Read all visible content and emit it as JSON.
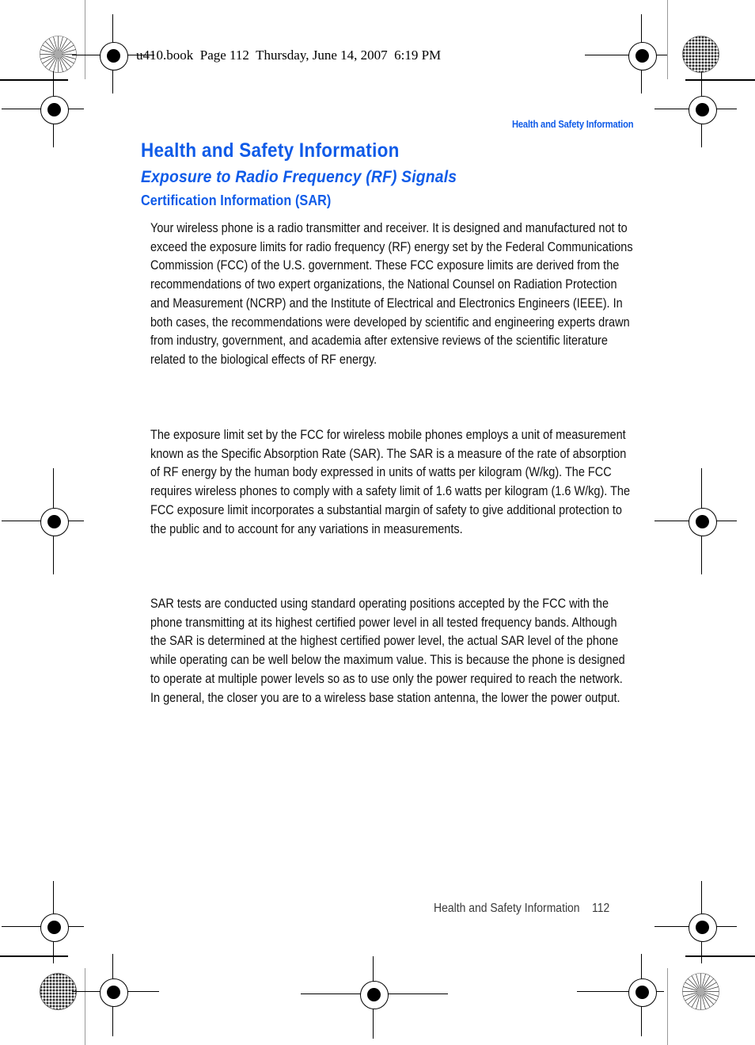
{
  "page": {
    "file_header": "u410.book  Page 112  Thursday, June 14, 2007  6:19 PM",
    "running_head": "Health and Safety Information",
    "accent_color": "#0f5be8",
    "body_color": "#111111",
    "footer_color": "#3a3a3a"
  },
  "headings": {
    "h1": "Health and Safety Information",
    "h2": "Exposure to Radio Frequency (RF) Signals",
    "h3": "Certification Information (SAR)"
  },
  "body": {
    "paragraph_1": "Your wireless phone is a radio transmitter and receiver. It is designed and manufactured not to exceed the exposure limits for radio frequency (RF) energy set by the Federal Communications Commission (FCC) of the U.S. government. These FCC exposure limits are derived from the recommendations of two expert organizations, the National Counsel on Radiation Protection and Measurement (NCRP) and the Institute of Electrical and Electronics Engineers (IEEE). In both cases, the recommendations were developed by scientific and engineering experts drawn from industry, government, and academia after extensive reviews of the scientific literature related to the biological effects of RF energy.",
    "paragraph_2": "The exposure limit set by the FCC for wireless mobile phones employs a unit of measurement known as the Specific Absorption Rate (SAR). The SAR is a measure of the rate of absorption of RF energy by the human body expressed in units of watts per kilogram (W/kg). The FCC requires wireless phones to comply with a safety limit of 1.6 watts per kilogram (1.6 W/kg). The FCC exposure limit incorporates a substantial margin of safety to give additional protection to the public and to account for any variations in measurements.",
    "paragraph_3": "SAR tests are conducted using standard operating positions accepted by the FCC with the phone transmitting at its highest certified power level in all tested frequency bands. Although the SAR is determined at the highest certified power level, the actual SAR level of the phone while operating can be well below the maximum value. This is because the phone is designed to operate at multiple power levels so as to use only the power required to reach the network. In general, the closer you are to a wireless base station antenna, the lower the power output."
  },
  "footer": {
    "section": "Health and Safety Information",
    "page_number": "112",
    "text": "Health and Safety Information    112"
  }
}
